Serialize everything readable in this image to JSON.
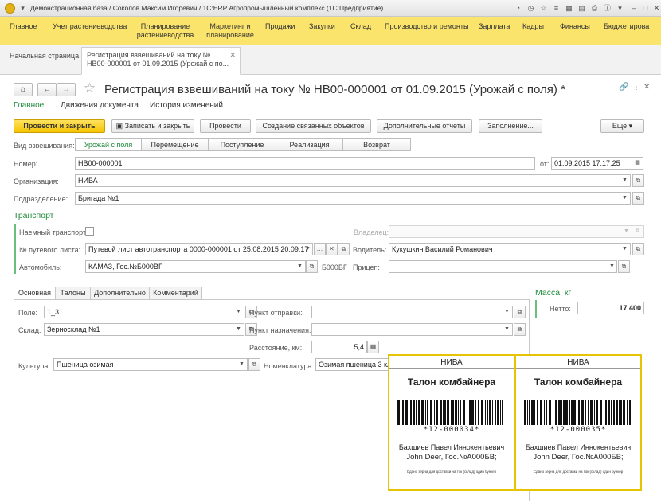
{
  "window": {
    "title": "Демонстрационная база / Соколов Максим Игоревич / 1С:ERP Агропромышленный комплекс (1С:Предприятие)"
  },
  "main_menu": [
    "Главное",
    "Учет растениеводства",
    "Планирование растениеводства",
    "Маркетинг и планирование",
    "Продажи",
    "Закупки",
    "Склад",
    "Производство и ремонты",
    "Зарплата",
    "Кадры",
    "Финансы",
    "Бюджетирова"
  ],
  "open_tabs": {
    "home": "Начальная страница",
    "current_line1": "Регистрация взвешиваний на току №",
    "current_line2": "НВ00-000001 от 01.09.2015 (Урожай с по..."
  },
  "form": {
    "title": "Регистрация взвешиваний на току № НВ00-000001 от 01.09.2015 (Урожай с поля)",
    "modified_mark": "*",
    "tabs": [
      "Главное",
      "Движения документа",
      "История изменений"
    ]
  },
  "toolbar": {
    "post_close": "Провести и закрыть",
    "save_close": "Записать и закрыть",
    "post": "Провести",
    "create_related": "Создание связанных объектов",
    "reports": "Дополнительные отчеты",
    "fill": "Заполнение...",
    "more": "Еще"
  },
  "weighing_type": {
    "label": "Вид взвешивания:",
    "options": [
      "Урожай с поля",
      "Перемещение",
      "Поступление",
      "Реализация",
      "Возврат"
    ]
  },
  "fields": {
    "number_label": "Номер:",
    "number": "НВ00-000001",
    "date_label": "от:",
    "date": "01.09.2015 17:17:25",
    "org_label": "Организация:",
    "org": "НИВА",
    "dept_label": "Подразделение:",
    "dept": "Бригада №1"
  },
  "transport": {
    "section": "Транспорт",
    "hired_label": "Наемный транспорт:",
    "owner_label": "Владелец:",
    "waybill_label": "№ путевого листа:",
    "waybill": "Путевой лист автотранспорта 0000-000001 от 25.08.2015 20:09:17",
    "driver_label": "Водитель:",
    "driver": "Кукушкин Василий Романович",
    "car_label": "Автомобиль:",
    "car": "КАМАЗ, Гос.№Б000ВГ",
    "car_plate": "Б000ВГ",
    "trailer_label": "Прицеп:"
  },
  "mass": {
    "section": "Масса, кг",
    "net_label": "Нетто:",
    "net": "17 400"
  },
  "panel_tabs": [
    "Основная",
    "Талоны",
    "Дополнительно",
    "Комментарий"
  ],
  "main_tab": {
    "field_label": "Поле:",
    "field": "1_3",
    "warehouse_label": "Склад:",
    "warehouse": "Зерносклад №1",
    "crop_label": "Культура:",
    "crop": "Пшеница озимая",
    "from_label": "Пункт отправки:",
    "to_label": "Пункт назначения:",
    "distance_label": "Расстояние, км:",
    "distance": "5,4",
    "nomen_label": "Номенклатура:",
    "nomen": "Озимая пшеница 3 кл"
  },
  "coupons": [
    {
      "org": "НИВА",
      "title": "Талон комбайнера",
      "code": "*12-000034*",
      "name": "Бахшиев Павел Иннокентьевич",
      "car": "John Deer, Гос.№А000БВ;",
      "note": "Сдано зерна для доставки на ток (склад) один бункер"
    },
    {
      "org": "НИВА",
      "title": "Талон комбайнера",
      "code": "*12-000035*",
      "name": "Бахшиев Павел Иннокентьевич",
      "car": "John Deer, Гос.№А000БВ;",
      "note": "Сдано зерна для доставки на ток (склад) один бункер"
    }
  ]
}
